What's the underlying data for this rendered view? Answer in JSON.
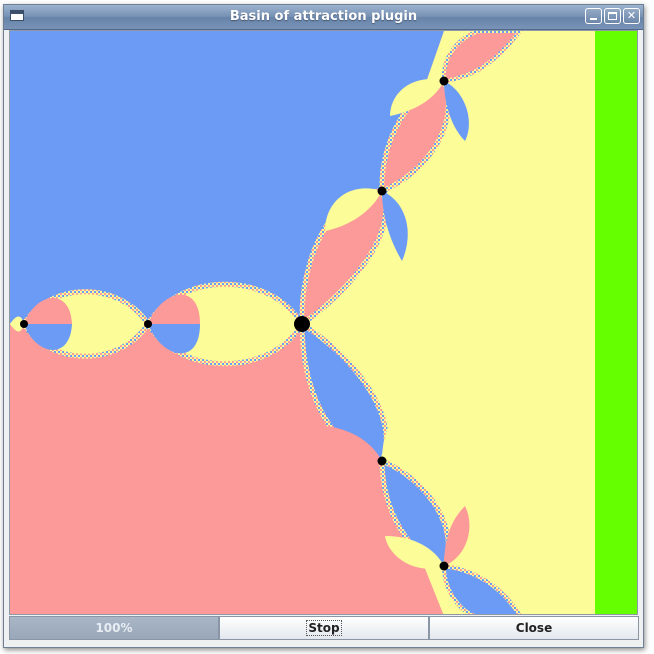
{
  "window": {
    "title": "Basin of attraction plugin"
  },
  "colors": {
    "basin_blue": "#6b9bf5",
    "basin_pink": "#fc9999",
    "basin_yellow": "#fcfc99",
    "strip_green": "#66ff00",
    "fixed_points": "#000000"
  },
  "statusbar": {
    "progress_label": "100%",
    "progress_value": 1.0,
    "stop_label": "Stop",
    "close_label": "Close"
  },
  "icons": {
    "app": "window-icon",
    "minimize": "minimize-icon",
    "maximize": "maximize-icon",
    "close": "close-icon"
  }
}
